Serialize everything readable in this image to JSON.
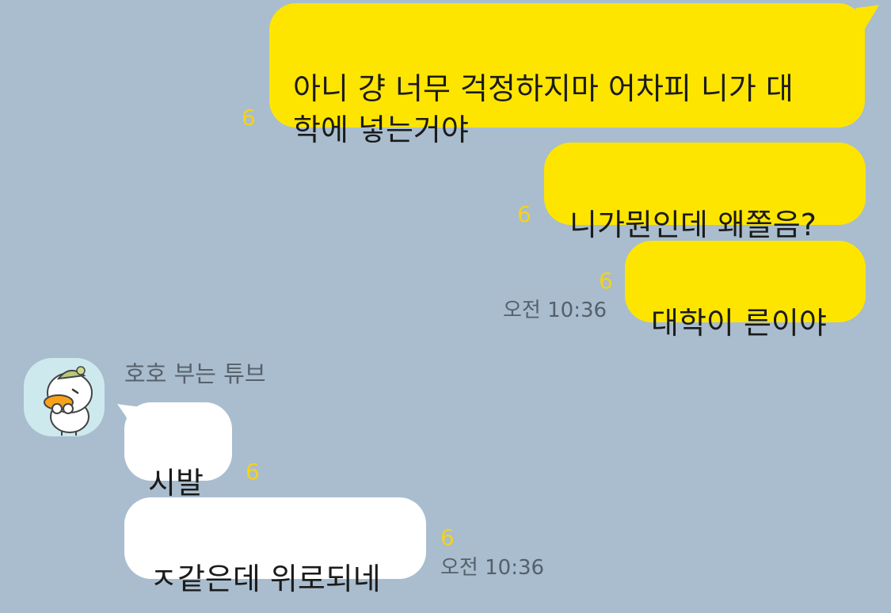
{
  "messages_outgoing": [
    {
      "text": "아니 걍 너무 걱정하지마 어차피 니가 대\n학에 넣는거야",
      "unread": "6"
    },
    {
      "text": "니가뭔인데 왜쫄음?",
      "unread": "6"
    },
    {
      "text": "대학이 른이야",
      "unread": "6",
      "time": "오전 10:36"
    }
  ],
  "sender": {
    "name": "호호 부는 튜브",
    "avatar_icon": "tube-duck-avatar-icon"
  },
  "messages_incoming": [
    {
      "text": "시발",
      "unread": "6"
    },
    {
      "text": "ㅈ같은데 위로되네",
      "unread": "6",
      "time": "오전 10:36"
    }
  ],
  "colors": {
    "background": "#a9bdce",
    "my_bubble": "#fee500",
    "their_bubble": "#ffffff",
    "unread": "#f4d21a"
  }
}
